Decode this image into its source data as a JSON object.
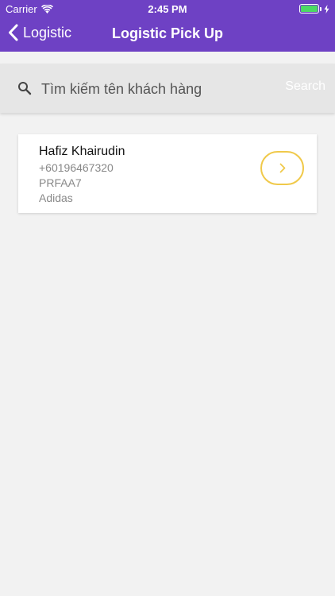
{
  "status_bar": {
    "carrier": "Carrier",
    "time": "2:45 PM",
    "battery_level": 1.0
  },
  "nav": {
    "back_label": "Logistic",
    "title": "Logistic Pick Up"
  },
  "search": {
    "placeholder": "Tìm kiếm tên khách hàng",
    "value": "",
    "button_label": "Search"
  },
  "customers": [
    {
      "name": "Hafiz Khairudin",
      "phone": "+60196467320",
      "code": "PRFAA7",
      "brand": "Adidas"
    }
  ],
  "colors": {
    "header": "#6e41c4",
    "accent": "#f0c94a",
    "background": "#f2f2f2"
  },
  "icons": [
    "wifi-icon",
    "battery-icon",
    "charging-icon",
    "back-chevron-icon",
    "search-icon",
    "chevron-right-icon"
  ]
}
